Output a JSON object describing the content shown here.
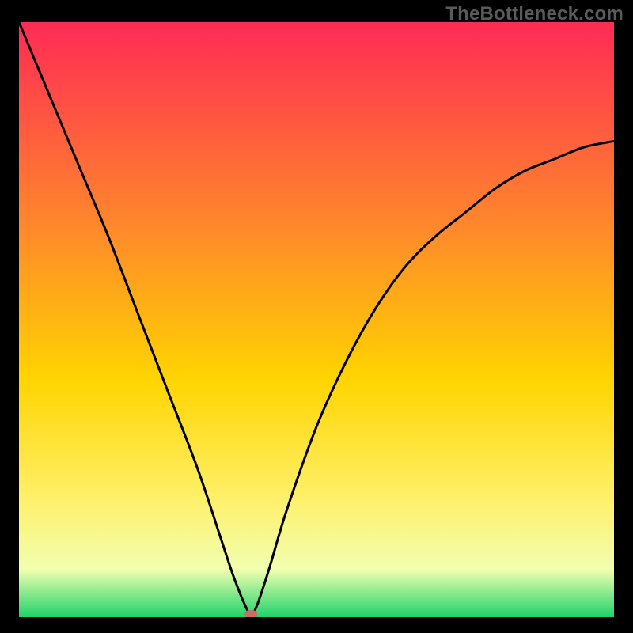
{
  "watermark": "TheBottleneck.com",
  "chart_data": {
    "type": "line",
    "title": "",
    "xlabel": "",
    "ylabel": "",
    "xlim": [
      0,
      100
    ],
    "ylim": [
      0,
      100
    ],
    "grid": false,
    "legend": false,
    "background_gradient_stops": [
      {
        "offset": 0,
        "color": "#ff2a55"
      },
      {
        "offset": 35,
        "color": "#ff8a2a"
      },
      {
        "offset": 60,
        "color": "#ffd400"
      },
      {
        "offset": 80,
        "color": "#fff06a"
      },
      {
        "offset": 92,
        "color": "#f1ffb0"
      },
      {
        "offset": 100,
        "color": "#1fd36a"
      }
    ],
    "background_gradient_direction": "top-to-bottom",
    "marker": {
      "x": 39,
      "y": 0.5,
      "color": "#cf6b65"
    },
    "series": [
      {
        "name": "curve",
        "x": [
          0,
          5,
          10,
          15,
          20,
          25,
          30,
          34,
          36,
          38,
          39,
          40,
          42,
          45,
          50,
          55,
          60,
          65,
          70,
          75,
          80,
          85,
          90,
          95,
          100
        ],
        "y": [
          100,
          88,
          76,
          64,
          51,
          38,
          25,
          13,
          7,
          2,
          0.5,
          2,
          8,
          18,
          32,
          43,
          52,
          59,
          64,
          68,
          72,
          75,
          77,
          79,
          80
        ]
      }
    ]
  }
}
